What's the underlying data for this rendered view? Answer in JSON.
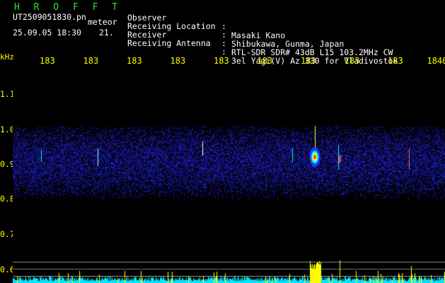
{
  "header": {
    "app_title": "H R O F F T",
    "filename": "UT2509051830.pn",
    "meteor_label": "meteor",
    "datetime": "25.09.05 18:30",
    "count": "21.",
    "info": [
      {
        "key": "Observer",
        "value": "Masaki Kano"
      },
      {
        "key": "Receiving Location",
        "value": "Shibukawa, Gunma, Japan"
      },
      {
        "key": "Receiver",
        "value": "RTL-SDR SDR# 43dB L15 103.2MHz CW"
      },
      {
        "key": "Receiving Antenna",
        "value": "3el Yagi(V) Az 330 for Vladivostok"
      }
    ]
  },
  "time_axis": {
    "ticks": [
      "183",
      "183",
      "183",
      "183",
      "183",
      "183",
      "183",
      "183",
      "183",
      "1840"
    ]
  },
  "freq_axis": {
    "unit": "kHz",
    "labels": [
      "1.1",
      "1.0",
      "0.9",
      "0.8",
      "0.7",
      "0.6"
    ]
  },
  "colors": {
    "title": "#2ee62e",
    "axis": "#ffff00",
    "text": "#ffffff",
    "noise_blue": "#1a1aff",
    "echo_red": "#ff2020",
    "echo_yellow": "#ffff00",
    "floor_cyan": "#00e5ff"
  }
}
